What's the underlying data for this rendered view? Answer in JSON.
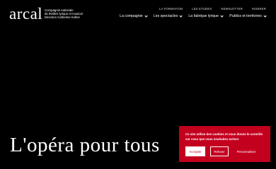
{
  "header": {
    "logo": "arcal",
    "tagline": [
      "Compagnie nationale",
      "de théâtre lyrique et musical",
      "Direction Catherine Kollen"
    ]
  },
  "utility_nav": [
    "LA FORMATION",
    "LES ETUDES",
    "NEWSLETTER",
    "INSERER"
  ],
  "main_nav": [
    {
      "label": "La compagnie",
      "icon": "chevron-down-icon"
    },
    {
      "label": "Les spectacles",
      "icon": "chevron-down-icon"
    },
    {
      "label": "La fabrique lyrique",
      "icon": "chevron-down-icon"
    },
    {
      "label": "Publics et territoires",
      "icon": "chevron-down-icon"
    }
  ],
  "hero": {
    "title": "L'opéra pour tous"
  },
  "cookie_banner": {
    "text": "Ce site utilise des cookies et vous donne le contrôle sur ceux que vous souhaitez activer",
    "accept_label": "Accepter",
    "refuse_label": "Refuser",
    "customize_label": "Personnaliser",
    "background_color": "#c4001f"
  }
}
